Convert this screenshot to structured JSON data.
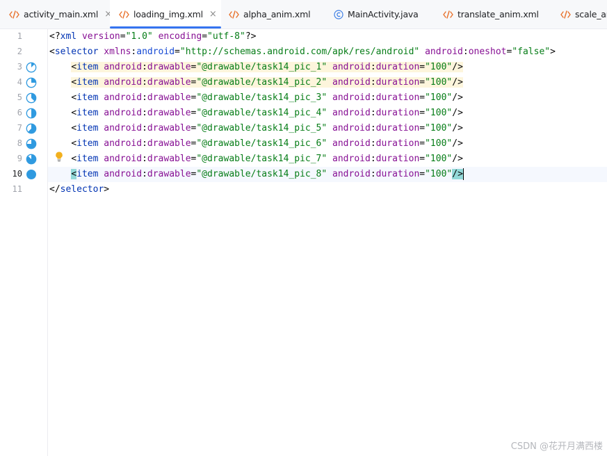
{
  "tabs": [
    {
      "label": "activity_main.xml",
      "icon": "xml-file-icon",
      "closable": true,
      "active": false
    },
    {
      "label": "loading_img.xml",
      "icon": "xml-file-icon",
      "closable": true,
      "active": true
    },
    {
      "label": "alpha_anim.xml",
      "icon": "xml-file-icon",
      "closable": false,
      "active": false
    },
    {
      "label": "MainActivity.java",
      "icon": "java-class-icon",
      "closable": false,
      "active": false
    },
    {
      "label": "translate_anim.xml",
      "icon": "xml-file-icon",
      "closable": false,
      "active": false
    },
    {
      "label": "scale_an",
      "icon": "xml-file-icon",
      "closable": false,
      "active": false
    }
  ],
  "editor": {
    "current_line": 10,
    "line_numbers": [
      "1",
      "2",
      "3",
      "4",
      "5",
      "6",
      "7",
      "8",
      "9",
      "10",
      "11"
    ],
    "lines": {
      "l1": {
        "decl_open": "<?",
        "xml": "xml",
        "version_attr": "version",
        "version_val": "\"1.0\"",
        "enc_attr": "encoding",
        "enc_val": "\"utf-8\"",
        "decl_close": "?>"
      },
      "l2": {
        "open": "<",
        "tag": "selector",
        "xmlns": "xmlns",
        "android_ns": "android",
        "xmlns_val": "\"http://schemas.android.com/apk/res/android\"",
        "oneshot_ns": "android",
        "oneshot_attr": "oneshot",
        "oneshot_val": "\"false\"",
        "close": ">"
      },
      "items": [
        {
          "indent": "    ",
          "open": "<",
          "tag": "item",
          "ns1": "android",
          "attr1": "drawable",
          "val1": "\"@drawable/task14_pic_1\"",
          "ns2": "android",
          "attr2": "duration",
          "val2": "\"100\"",
          "close": "/>",
          "frame_progress": 0.125
        },
        {
          "indent": "    ",
          "open": "<",
          "tag": "item",
          "ns1": "android",
          "attr1": "drawable",
          "val1": "\"@drawable/task14_pic_2\"",
          "ns2": "android",
          "attr2": "duration",
          "val2": "\"100\"",
          "close": "/>",
          "frame_progress": 0.25
        },
        {
          "indent": "    ",
          "open": "<",
          "tag": "item",
          "ns1": "android",
          "attr1": "drawable",
          "val1": "\"@drawable/task14_pic_3\"",
          "ns2": "android",
          "attr2": "duration",
          "val2": "\"100\"",
          "close": "/>",
          "frame_progress": 0.375
        },
        {
          "indent": "    ",
          "open": "<",
          "tag": "item",
          "ns1": "android",
          "attr1": "drawable",
          "val1": "\"@drawable/task14_pic_4\"",
          "ns2": "android",
          "attr2": "duration",
          "val2": "\"100\"",
          "close": "/>",
          "frame_progress": 0.5
        },
        {
          "indent": "    ",
          "open": "<",
          "tag": "item",
          "ns1": "android",
          "attr1": "drawable",
          "val1": "\"@drawable/task14_pic_5\"",
          "ns2": "android",
          "attr2": "duration",
          "val2": "\"100\"",
          "close": "/>",
          "frame_progress": 0.625
        },
        {
          "indent": "    ",
          "open": "<",
          "tag": "item",
          "ns1": "android",
          "attr1": "drawable",
          "val1": "\"@drawable/task14_pic_6\"",
          "ns2": "android",
          "attr2": "duration",
          "val2": "\"100\"",
          "close": "/>",
          "frame_progress": 0.75
        },
        {
          "indent": "    ",
          "open": "<",
          "tag": "item",
          "ns1": "android",
          "attr1": "drawable",
          "val1": "\"@drawable/task14_pic_7\"",
          "ns2": "android",
          "attr2": "duration",
          "val2": "\"100\"",
          "close": "/>",
          "frame_progress": 0.875
        },
        {
          "indent": "    ",
          "open": "<",
          "tag": "item",
          "ns1": "android",
          "attr1": "drawable",
          "val1": "\"@drawable/task14_pic_8\"",
          "ns2": "android",
          "attr2": "duration",
          "val2": "\"100\"",
          "close": "/>",
          "frame_progress": 1.0
        }
      ],
      "l11": {
        "open": "</",
        "tag": "selector",
        "close": ">"
      }
    },
    "colon": ":",
    "equals": "=",
    "space": " "
  },
  "colors": {
    "tag": "#0033b3",
    "attribute": "#871094",
    "string": "#067d17",
    "active_tab_underline": "#3574f0",
    "xml_icon": "#e8702a",
    "gutter_icon": "#2f9ae0",
    "bulb": "#f2b01e"
  },
  "watermark": "CSDN @花开月满西楼"
}
